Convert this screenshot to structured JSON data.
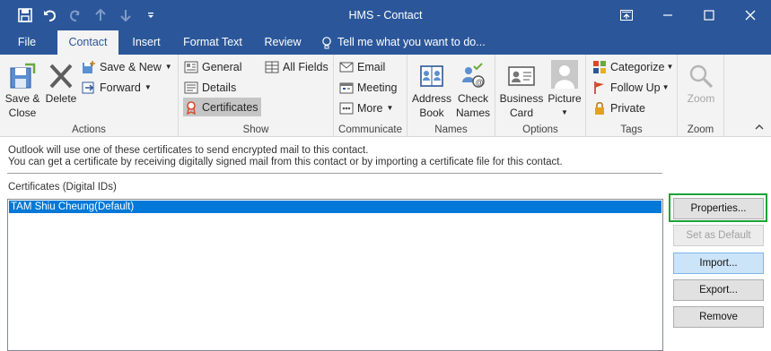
{
  "window": {
    "title": "HMS - Contact",
    "controls": [
      "ribbon-display-options",
      "minimize",
      "maximize",
      "close"
    ]
  },
  "qat": {
    "icons": [
      "save-icon",
      "undo-icon",
      "redo-icon",
      "up-arrow-icon",
      "down-arrow-icon",
      "customize-qat-icon"
    ]
  },
  "tabs": [
    {
      "label": "File"
    },
    {
      "label": "Contact",
      "active": true
    },
    {
      "label": "Insert"
    },
    {
      "label": "Format Text"
    },
    {
      "label": "Review"
    },
    {
      "label": "Tell me what you want to do..."
    }
  ],
  "ribbon": {
    "actions": {
      "label": "Actions",
      "save_close": "Save &",
      "save_close2": "Close",
      "delete": "Delete",
      "save_new": "Save & New",
      "forward": "Forward"
    },
    "show": {
      "label": "Show",
      "general": "General",
      "details": "Details",
      "certificates": "Certificates",
      "all_fields": "All Fields"
    },
    "communicate": {
      "label": "Communicate",
      "email": "Email",
      "meeting": "Meeting",
      "more": "More"
    },
    "names": {
      "label": "Names",
      "address_book_1": "Address",
      "address_book_2": "Book",
      "check_names_1": "Check",
      "check_names_2": "Names"
    },
    "options": {
      "label": "Options",
      "business_card_1": "Business",
      "business_card_2": "Card",
      "picture": "Picture"
    },
    "tags": {
      "label": "Tags",
      "categorize": "Categorize",
      "follow_up": "Follow Up",
      "private": "Private"
    },
    "zoom": {
      "label": "Zoom",
      "zoom": "Zoom"
    }
  },
  "content": {
    "info_line1": "Outlook will use one of these certificates to send encrypted mail to this contact.",
    "info_line2": "You can get a certificate by receiving digitally signed mail from this contact or by importing a certificate file for this contact.",
    "certificates_label": "Certificates (Digital IDs)",
    "certificates": [
      {
        "name": "TAM Shiu Cheung(Default)",
        "selected": true
      }
    ],
    "buttons": {
      "properties": "Properties...",
      "set_default": "Set as Default",
      "import": "Import...",
      "export": "Export...",
      "remove": "Remove"
    }
  },
  "colors": {
    "accent": "#2b579a",
    "selection": "#0078d7",
    "focus_highlight": "#1aa339"
  }
}
